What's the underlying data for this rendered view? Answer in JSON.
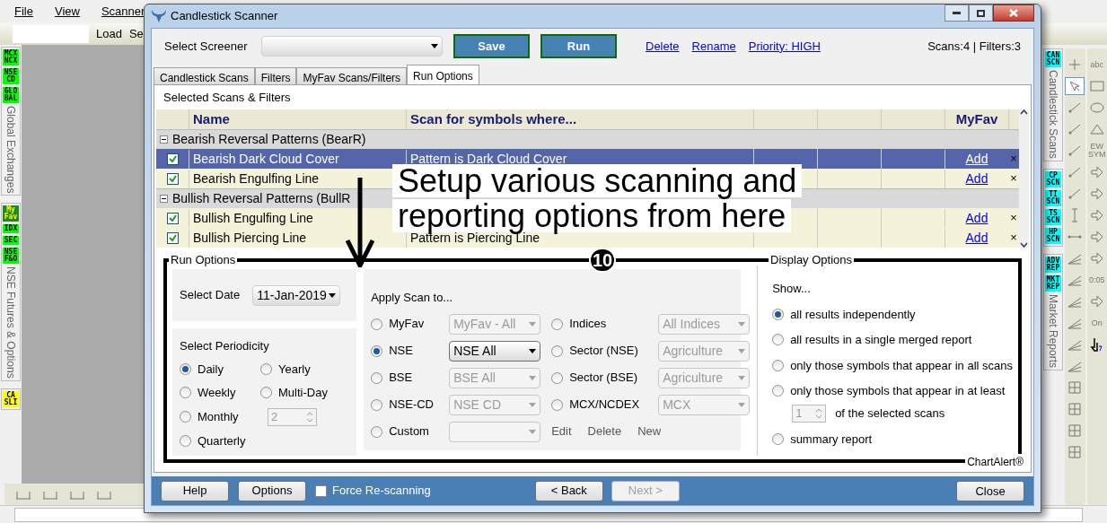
{
  "menu": [
    {
      "label": "File"
    },
    {
      "label": "View"
    },
    {
      "label": "Scanner"
    }
  ],
  "toolbar": {
    "buttons": [
      {
        "label": "Load"
      },
      {
        "label": "Se"
      }
    ]
  },
  "left_strip": {
    "groups": [
      {
        "badges": [
          {
            "label": "MCX NCX",
            "color": "#00ff00"
          },
          {
            "label": "NSE CD",
            "color": "#00ff00"
          },
          {
            "label": "GLO BAL",
            "color": "#00ff00"
          }
        ],
        "title": "Global Exchanges"
      },
      {
        "badges": [
          {
            "label": "My Fav",
            "color": "#1f8a1f"
          },
          {
            "label": "IDX",
            "color": "#00ff00"
          },
          {
            "label": "SEC",
            "color": "#00ff00"
          },
          {
            "label": "NSE F&O",
            "color": "#00ff00"
          }
        ],
        "title": "NSE Futures & Options"
      },
      {
        "badges": [
          {
            "label": "CA SLI",
            "color": "#ffff00"
          }
        ]
      }
    ]
  },
  "right_strip": {
    "groups": [
      {
        "badges": [
          {
            "label": "CAN SCN",
            "color": "#00ffff"
          }
        ],
        "title": "Candlestick Scans"
      },
      {
        "badges": [
          {
            "label": "CP SCN",
            "color": "#00ffff"
          },
          {
            "label": "TI SCN",
            "color": "#00ffff"
          },
          {
            "label": "TS SCN",
            "color": "#00ffff"
          },
          {
            "label": "HP SCN",
            "color": "#00ffff"
          }
        ]
      },
      {
        "badges": [
          {
            "label": "ADV REP",
            "color": "#00ffff"
          },
          {
            "label": "MKT REP",
            "color": "#00ffff"
          }
        ],
        "title": "Market Reports"
      }
    ],
    "tools_a": [
      {
        "kind": "plus",
        "selected": false
      },
      {
        "kind": "pointer",
        "selected": true
      },
      {
        "kind": "line",
        "selected": false
      },
      {
        "kind": "line",
        "selected": false
      },
      {
        "kind": "line",
        "selected": false
      },
      {
        "kind": "line",
        "selected": false
      },
      {
        "kind": "line",
        "selected": false
      },
      {
        "kind": "vline",
        "selected": false
      },
      {
        "kind": "hline",
        "selected": false
      },
      {
        "kind": "fib",
        "selected": false
      },
      {
        "kind": "fib",
        "selected": false
      },
      {
        "kind": "fib",
        "selected": false
      },
      {
        "kind": "fib",
        "selected": false
      },
      {
        "kind": "fib",
        "selected": false
      },
      {
        "kind": "fib",
        "selected": false
      },
      {
        "kind": "grid",
        "selected": false
      },
      {
        "kind": "grid",
        "selected": false
      },
      {
        "kind": "grid",
        "selected": false
      },
      {
        "kind": "grid",
        "selected": false
      }
    ],
    "tools_b": [
      {
        "kind": "text",
        "label": "abc",
        "selected": false
      },
      {
        "kind": "rect",
        "selected": false
      },
      {
        "kind": "ellipse",
        "selected": false
      },
      {
        "kind": "triangle",
        "selected": false
      },
      {
        "kind": "text",
        "label": "EW SYM",
        "selected": false
      },
      {
        "kind": "arrow",
        "selected": false
      },
      {
        "kind": "arrow",
        "selected": false
      },
      {
        "kind": "arrow",
        "selected": false
      },
      {
        "kind": "arrow",
        "selected": false
      },
      {
        "kind": "arrow",
        "selected": false
      },
      {
        "kind": "text",
        "label": "0:05",
        "selected": false
      },
      {
        "kind": "arrow",
        "selected": false
      },
      {
        "kind": "text",
        "label": "On",
        "selected": false
      },
      {
        "kind": "cursor",
        "selected": false
      }
    ]
  },
  "dialog": {
    "title": "Candlestick Scanner",
    "screener": {
      "label": "Select Screener",
      "buttons": [
        {
          "label": "Save"
        },
        {
          "label": "Run"
        }
      ],
      "links": [
        {
          "label": "Delete"
        },
        {
          "label": "Rename"
        },
        {
          "label": "Priority: HIGH"
        }
      ],
      "counts": "Scans:4 | Filters:3"
    },
    "tabs": [
      {
        "label": "Candlestick Scans",
        "selected": false
      },
      {
        "label": "Filters",
        "selected": false
      },
      {
        "label": "MyFav Scans/Filters",
        "selected": false
      },
      {
        "label": "Run Options",
        "selected": true
      }
    ],
    "section_title": "Selected Scans & Filters",
    "table": {
      "columns": [
        "Name",
        "Scan for symbols where...",
        "MyFav"
      ],
      "groups": [
        {
          "name": "Bearish Reversal Patterns (BearR)",
          "expanded": true,
          "rows": [
            {
              "name": "Bearish Dark Cloud Cover",
              "scan": "Pattern is Dark Cloud Cover",
              "checked": true,
              "selected": true,
              "myfav": "Add",
              "remove": "×"
            },
            {
              "name": "Bearish Engulfing Line",
              "checked": true,
              "selected": false,
              "myfav": "Add",
              "remove": "×"
            }
          ]
        },
        {
          "name": "Bullish Reversal Patterns (BullR",
          "expanded": true,
          "rows": [
            {
              "name": "Bullish Engulfing Line",
              "checked": true,
              "selected": false,
              "myfav": "Add",
              "remove": "×"
            },
            {
              "name": "Bullish Piercing Line",
              "scan": "Pattern is Piercing Line",
              "checked": true,
              "selected": false,
              "myfav": "Add",
              "remove": "×"
            }
          ]
        }
      ]
    },
    "run_options": {
      "title": "Run Options",
      "date_label": "Select Date",
      "date": "11-Jan-2019",
      "periodicity_label": "Select Periodicity",
      "periods": [
        {
          "label": "Daily",
          "selected": true
        },
        {
          "label": "Yearly",
          "selected": false
        },
        {
          "label": "Weekly",
          "selected": false
        },
        {
          "label": "Multi-Day",
          "selected": false
        },
        {
          "label": "Monthly",
          "selected": false
        }
      ],
      "multi_day": {
        "value": "2",
        "disabled": true
      },
      "period_last": {
        "label": "Quarterly",
        "selected": false
      }
    },
    "apply": {
      "title": "Apply Scan to...",
      "left": [
        {
          "label": "MyFav",
          "value": "MyFav - All",
          "selected": false,
          "disabled": true
        },
        {
          "label": "NSE",
          "value": "NSE All",
          "selected": true,
          "disabled": false
        },
        {
          "label": "BSE",
          "value": "BSE All",
          "selected": false,
          "disabled": true
        },
        {
          "label": "NSE-CD",
          "value": "NSE CD",
          "selected": false,
          "disabled": true
        },
        {
          "label": "Custom",
          "selected": false,
          "disabled": true
        }
      ],
      "right": [
        {
          "label": "Indices",
          "value": "All Indices",
          "selected": false,
          "disabled": true
        },
        {
          "label": "Sector (NSE)",
          "value": "Agriculture",
          "selected": false,
          "disabled": true
        },
        {
          "label": "Sector (BSE)",
          "value": "Agriculture",
          "selected": false,
          "disabled": true
        },
        {
          "label": "MCX/NCDEX",
          "value": "MCX",
          "selected": false,
          "disabled": true
        }
      ],
      "links": [
        {
          "label": "Edit"
        },
        {
          "label": "Delete"
        },
        {
          "label": "New"
        }
      ]
    },
    "display": {
      "title": "Display Options",
      "show": "Show...",
      "options": [
        {
          "label": "all results independently",
          "selected": true
        },
        {
          "label": "all results in a single merged report",
          "selected": false
        },
        {
          "label": "only those symbols that appear in all scans",
          "selected": false
        },
        {
          "label": "only those symbols that appear in at least",
          "selected": false
        }
      ],
      "min_scans": {
        "value": "1",
        "suffix": "of the selected scans",
        "disabled": true
      },
      "last": {
        "label": "summary report",
        "selected": false
      }
    },
    "footer": {
      "left": [
        {
          "label": "Help",
          "disabled": false
        },
        {
          "label": "Options",
          "disabled": false
        }
      ],
      "force": {
        "label": "Force Re-scanning",
        "checked": false
      },
      "nav": [
        {
          "label": "< Back",
          "disabled": false
        },
        {
          "label": "Next >",
          "disabled": true
        }
      ],
      "close": {
        "label": "Close",
        "disabled": false
      }
    }
  },
  "annotation": {
    "callout": [
      "Setup various scanning and",
      "reporting options from here"
    ],
    "step": "10",
    "brand": "ChartAlert®"
  }
}
